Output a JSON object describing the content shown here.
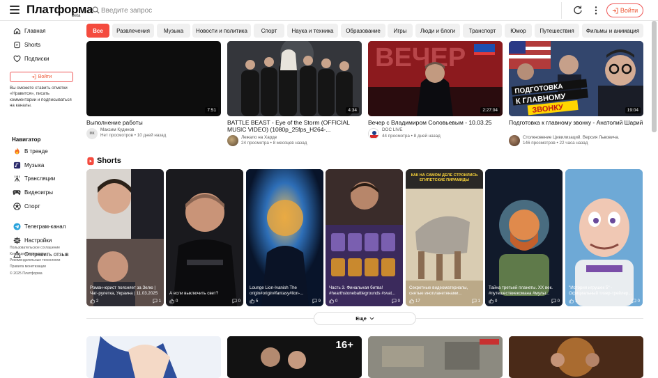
{
  "header": {
    "logo": "Платформа",
    "logo_badge": "Beta",
    "search_placeholder": "Введите запрос",
    "login_label": "Войти"
  },
  "sidebar": {
    "main_items": [
      {
        "label": "Главная",
        "icon": "home-icon"
      },
      {
        "label": "Shorts",
        "icon": "shorts-icon"
      },
      {
        "label": "Подписки",
        "icon": "heart-icon"
      }
    ],
    "login_label": "Войти",
    "note": "Вы сможете ставить отметки «Нравится», писать комментарии и подписываться на каналы.",
    "navigator_heading": "Навигатор",
    "navigator_items": [
      {
        "label": "В тренде",
        "icon": "fire-icon"
      },
      {
        "label": "Музыка",
        "icon": "music-icon"
      },
      {
        "label": "Трансляции",
        "icon": "broadcast-icon"
      },
      {
        "label": "Видеоигры",
        "icon": "gamepad-icon"
      },
      {
        "label": "Спорт",
        "icon": "ball-icon"
      }
    ],
    "extra_items": [
      {
        "label": "Телеграм-канал",
        "icon": "telegram-icon"
      },
      {
        "label": "Настройки",
        "icon": "gear-icon"
      },
      {
        "label": "Отправить отзыв",
        "icon": "warning-icon"
      }
    ],
    "footer_links": [
      "Пользовательское соглашение",
      "Конфиденциальность",
      "Рекомендательные технологии",
      "Правила монетизации"
    ],
    "copyright": "© 2025 Платформа"
  },
  "chips": [
    "Все",
    "Развлечения",
    "Музыка",
    "Новости и политика",
    "Спорт",
    "Наука и техника",
    "Образование",
    "Игры",
    "Люди и блоги",
    "Транспорт",
    "Юмор",
    "Путешествия",
    "Фильмы и анимация"
  ],
  "videos": [
    {
      "title": "Выполнение работы",
      "duration": "7:51",
      "channel": "Максим Кудинов",
      "views": "Нет просмотров",
      "age": "10 дней назад",
      "avatar_text": "МК"
    },
    {
      "title": "BATTLE BEAST - Eye of the Storm (OFFICIAL MUSIC VIDEO) (1080p_25fps_H264-...",
      "duration": "4:34",
      "channel": "Лежало на Харде",
      "views": "24 просмотра",
      "age": "8 месяцев назад",
      "avatar_text": ""
    },
    {
      "title": "Вечер с Владимиром Соловьевым - 10.03.25",
      "duration": "2:27:04",
      "channel": "DOC LIVE",
      "views": "44 просмотра",
      "age": "8 дней назад",
      "avatar_text": ""
    },
    {
      "title": "Подготовка к главному звонку - Анатолий Шарий",
      "duration": "19:04",
      "channel": "Столкновение Цивилизаций. Версия Львовича.",
      "views": "146 просмотров",
      "age": "22 часа назад",
      "avatar_text": ""
    }
  ],
  "thumb_texts": {
    "video3_banner": "ВЕЧЕР",
    "video4_caption_top": "ПОДГОТОВКА",
    "video4_caption_mid": "К ГЛАВНОМУ",
    "video4_caption_bot": "ЗВОНКУ"
  },
  "shorts_heading": "Shorts",
  "shorts": [
    {
      "title": "Роман-юрист поясняет за Зелю | Чат-рулетка, Украина | 11.03.2025",
      "likes": "2",
      "comments": "1"
    },
    {
      "title": "А если выключить свет?",
      "likes": "0",
      "comments": "0"
    },
    {
      "title": "Lounge Lion-Ivanish The origin#origin#fantasy#lion-...",
      "likes": "5",
      "comments": "9"
    },
    {
      "title": "Часть 3. Финальная битва! #hearthstonebattlegrounds #svat...",
      "likes": "0",
      "comments": "0"
    },
    {
      "title": "Секретные видеоматериалы, снятые инопланетянами...",
      "likes": "17",
      "comments": "1",
      "overlay": "КАК НА САМОМ ДЕЛЕ СТРОИЛИСЬ ЕГИПЕТСКИЕ ПИРАМИДЫ"
    },
    {
      "title": "Тайна третьей планеты. XX век. #путешествиекомана #мульт...",
      "likes": "0",
      "comments": "0"
    },
    {
      "title": "\"История игрушек 5\" - Официальный тизер-трейлер...",
      "likes": "1",
      "comments": "0"
    }
  ],
  "more_label": "Еще",
  "bottom_badge": "16+",
  "colors": {
    "accent": "#f44b3e",
    "chip_bg": "#f0f0f0",
    "text": "#0f0f0f",
    "muted": "#666666"
  }
}
